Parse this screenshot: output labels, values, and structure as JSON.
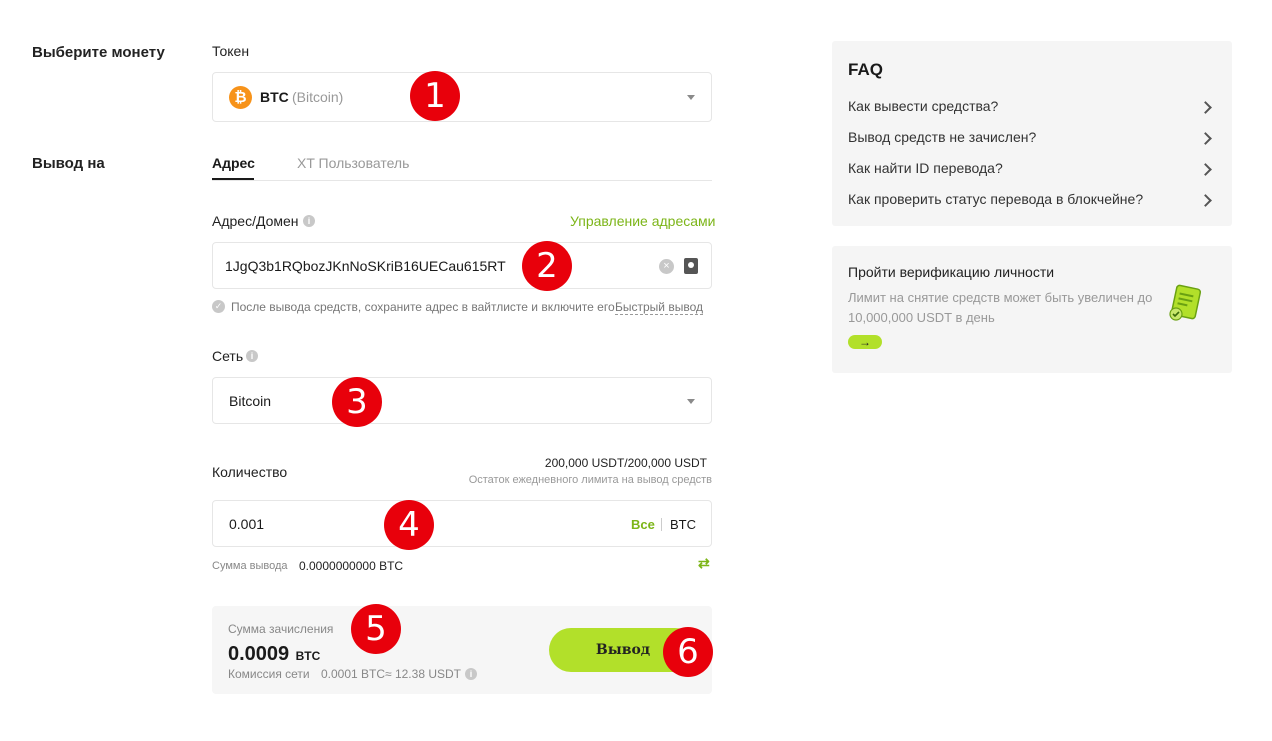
{
  "form": {
    "coin_label": "Выберите монету",
    "token_label": "Токен",
    "token_symbol": "BTC",
    "token_name": "(Bitcoin)",
    "withdraw_to_label": "Вывод на",
    "tabs": [
      {
        "label": "Адрес",
        "active": true
      },
      {
        "label": "XT Пользователь",
        "active": false
      }
    ],
    "address_label": "Адрес/Домен",
    "manage_addresses": "Управление адресами",
    "address_value": "1JgQ3b1RQbozJKnNoSKriB16UECau615RT",
    "address_hint": "После вывода средств, сохраните адрес в вайтлисте и включите его",
    "quick_withdraw": "Быстрый вывод",
    "network_label": "Сеть",
    "network_value": "Bitcoin",
    "amount_label": "Количество",
    "limit_value": "200,000 USDT/200,000 USDT",
    "limit_desc": "Остаток ежедневного лимита на вывод средств",
    "amount_value": "0.001",
    "all_label": "Все",
    "amount_unit": "BTC",
    "withdraw_sum_label": "Сумма вывода",
    "withdraw_sum_value": "0.0000000000 BTC",
    "credit_label": "Сумма зачисления",
    "credit_value": "0.0009",
    "credit_unit": "BTC",
    "fee_label": "Комиссия сети",
    "fee_value": "0.0001 BTC≈ 12.38 USDT",
    "submit_label": "Вывод"
  },
  "faq": {
    "title": "FAQ",
    "items": [
      "Как вывести средства?",
      "Вывод средств не зачислен?",
      "Как найти ID перевода?",
      "Как проверить статус перевода в блокчейне?"
    ]
  },
  "verify": {
    "title": "Пройти верификацию личности",
    "desc": "Лимит на снятие средств может быть увеличен до 10,000,000 USDT в день"
  },
  "badges": [
    "1",
    "2",
    "3",
    "4",
    "5",
    "6"
  ],
  "colors": {
    "accent_green": "#7cb518",
    "button_green": "#b2e02a",
    "btc_orange": "#f7931a",
    "badge_red": "#e8000b"
  }
}
